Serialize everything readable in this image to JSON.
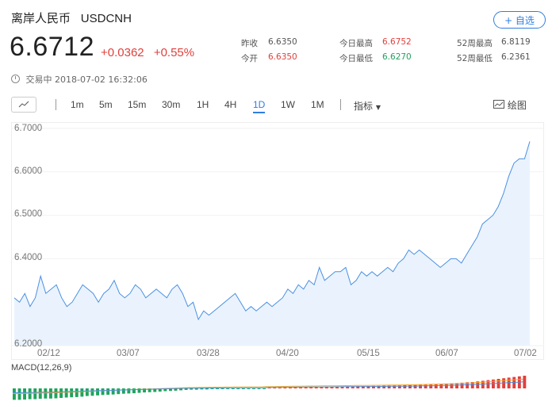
{
  "header": {
    "name": "离岸人民币",
    "code": "USDCNH",
    "watch_label": "+ 自选"
  },
  "quote": {
    "price": "6.6712",
    "change": "+0.0362",
    "change_pct": "+0.55%"
  },
  "stats": [
    {
      "label": "昨收",
      "value": "6.6350",
      "tone": "neutral"
    },
    {
      "label": "今开",
      "value": "6.6350",
      "tone": "red"
    },
    {
      "label": "今日最高",
      "value": "6.6752",
      "tone": "red"
    },
    {
      "label": "今日最低",
      "value": "6.6270",
      "tone": "green"
    },
    {
      "label": "52周最高",
      "value": "6.8119",
      "tone": "neutral"
    },
    {
      "label": "52周最低",
      "value": "6.2361",
      "tone": "neutral"
    }
  ],
  "status": {
    "state": "交易中",
    "datetime": "2018-07-02 16:32:06"
  },
  "toolbar": {
    "periods": [
      "1m",
      "5m",
      "15m",
      "30m",
      "1H",
      "4H",
      "1D",
      "1W",
      "1M"
    ],
    "active_period": "1D",
    "indicator_label": "指标",
    "draw_label": "绘图",
    "line_icon": "line-chart-icon",
    "draw_icon": "draw-chart-icon"
  },
  "colors": {
    "line": "#4a90e2",
    "area": "#eaf3fd",
    "up": "#e0403c",
    "down": "#1ea45d",
    "accent": "#2f7de1"
  },
  "chart_data": {
    "type": "area",
    "y_ticks": [
      "6.7000",
      "6.6000",
      "6.5000",
      "6.4000",
      "6.2000"
    ],
    "x_ticks": [
      "02/12",
      "03/07",
      "03/28",
      "04/20",
      "05/15",
      "06/07",
      "07/02"
    ],
    "ylim": [
      6.2,
      6.7
    ],
    "values": [
      6.31,
      6.3,
      6.32,
      6.29,
      6.31,
      6.36,
      6.32,
      6.33,
      6.34,
      6.31,
      6.29,
      6.3,
      6.32,
      6.34,
      6.33,
      6.32,
      6.3,
      6.32,
      6.33,
      6.35,
      6.32,
      6.31,
      6.32,
      6.34,
      6.33,
      6.31,
      6.32,
      6.33,
      6.32,
      6.31,
      6.33,
      6.34,
      6.32,
      6.29,
      6.3,
      6.26,
      6.28,
      6.27,
      6.28,
      6.29,
      6.3,
      6.31,
      6.32,
      6.3,
      6.28,
      6.29,
      6.28,
      6.29,
      6.3,
      6.29,
      6.3,
      6.31,
      6.33,
      6.32,
      6.34,
      6.33,
      6.35,
      6.34,
      6.38,
      6.35,
      6.36,
      6.37,
      6.37,
      6.38,
      6.34,
      6.35,
      6.37,
      6.36,
      6.37,
      6.36,
      6.37,
      6.38,
      6.37,
      6.39,
      6.4,
      6.42,
      6.41,
      6.42,
      6.41,
      6.4,
      6.39,
      6.38,
      6.39,
      6.4,
      6.4,
      6.39,
      6.41,
      6.43,
      6.45,
      6.48,
      6.49,
      6.5,
      6.52,
      6.55,
      6.59,
      6.62,
      6.63,
      6.63,
      6.67
    ],
    "macd": {
      "label": "MACD(12,26,9)",
      "histogram": [
        -0.9,
        -0.9,
        -0.88,
        -0.85,
        -0.85,
        -0.82,
        -0.8,
        -0.8,
        -0.78,
        -0.75,
        -0.72,
        -0.7,
        -0.68,
        -0.65,
        -0.6,
        -0.58,
        -0.55,
        -0.52,
        -0.5,
        -0.48,
        -0.45,
        -0.42,
        -0.4,
        -0.38,
        -0.35,
        -0.32,
        -0.3,
        -0.28,
        -0.25,
        -0.22,
        -0.2,
        -0.18,
        -0.15,
        -0.12,
        -0.1,
        -0.1,
        -0.08,
        -0.08,
        -0.06,
        -0.05,
        -0.05,
        -0.04,
        -0.04,
        -0.03,
        -0.03,
        -0.02,
        -0.02,
        -0.02,
        -0.01,
        0.02,
        0.03,
        0.04,
        0.05,
        0.06,
        0.07,
        0.08,
        0.09,
        0.1,
        0.1,
        0.11,
        0.12,
        0.13,
        0.14,
        0.15,
        0.16,
        0.17,
        0.18,
        0.18,
        0.19,
        0.2,
        0.2,
        0.21,
        0.22,
        0.23,
        0.24,
        0.25,
        0.26,
        0.27,
        0.28,
        0.3,
        0.32,
        0.34,
        0.36,
        0.38,
        0.4,
        0.42,
        0.45,
        0.48,
        0.5,
        0.55,
        0.6,
        0.65,
        0.7,
        0.75,
        0.8,
        0.85,
        0.9,
        0.95,
        1.0
      ]
    }
  }
}
